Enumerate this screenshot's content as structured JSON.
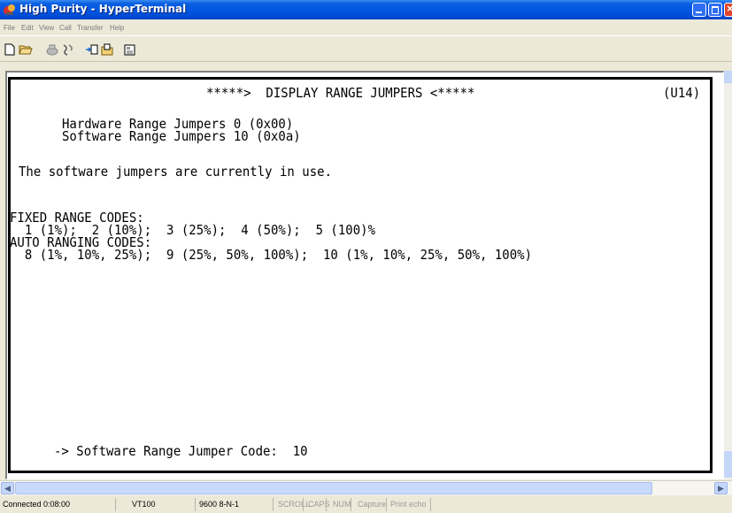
{
  "window": {
    "title": "High Purity - HyperTerminal"
  },
  "menu": [
    "File",
    "Edit",
    "View",
    "Call",
    "Transfer",
    "Help"
  ],
  "toolbar": {
    "icons": [
      "new-connection-icon",
      "open-icon",
      "call-icon",
      "disconnect-icon",
      "send-icon",
      "receive-icon",
      "properties-icon"
    ]
  },
  "terminal": {
    "header": "*****>  DISPLAY RANGE JUMPERS <*****",
    "unit": "(U14)",
    "hw_jumpers": "Hardware Range Jumpers 0 (0x00)",
    "sw_jumpers": "Software Range Jumpers 10 (0x0a)",
    "in_use_msg": "The software jumpers are currently in use.",
    "fixed_title": "FIXED RANGE CODES:",
    "fixed_codes": "  1 (1%);  2 (10%);  3 (25%);  4 (50%);  5 (100)%",
    "auto_title": "AUTO RANGING CODES:",
    "auto_codes": "  8 (1%, 10%, 25%);  9 (25%, 50%, 100%);  10 (1%, 10%, 25%, 50%, 100%)",
    "prompt": "-> Software Range Jumper Code:  10"
  },
  "statusbar": {
    "connected": "Connected 0:08:00",
    "emulation": "VT100",
    "port": "9600 8-N-1",
    "scroll": "SCROLL",
    "caps": "CAPS",
    "num": "NUM",
    "capture": "Capture",
    "print_echo": "Print echo"
  },
  "colors": {
    "titlebar": "#0054e3",
    "chrome": "#ece9d8",
    "terminal_bg": "#ffffff",
    "terminal_text": "#000000"
  }
}
